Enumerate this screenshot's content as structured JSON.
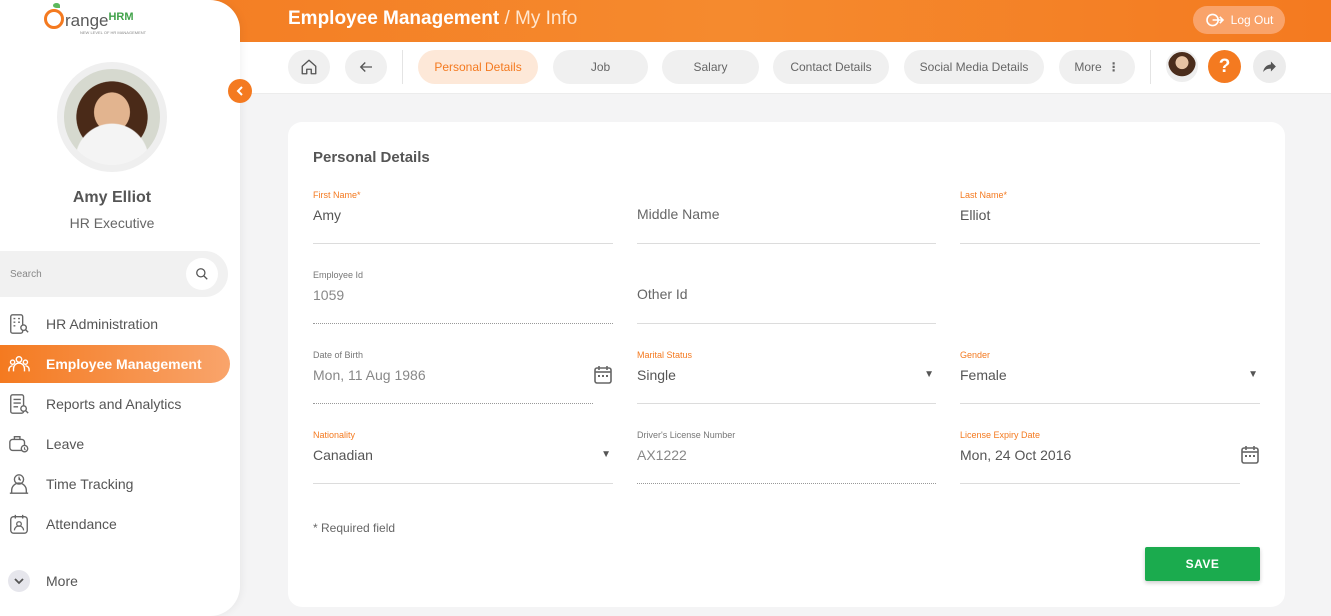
{
  "header": {
    "title": "Employee Management",
    "separator": "/",
    "subtitle": "My Info",
    "logout_label": "Log Out"
  },
  "subnav": {
    "tabs": [
      {
        "label": "Personal Details",
        "active": true
      },
      {
        "label": "Job"
      },
      {
        "label": "Salary"
      },
      {
        "label": "Contact Details"
      },
      {
        "label": "Social Media Details"
      },
      {
        "label": "More"
      }
    ],
    "help_glyph": "?"
  },
  "sidebar": {
    "logo_word": "range",
    "logo_hrm": "HRM",
    "logo_tagline": "NEW LEVEL OF HR MANAGEMENT",
    "user_name": "Amy Elliot",
    "user_role": "HR Executive",
    "search_placeholder": "Search",
    "items": [
      {
        "label": "HR Administration",
        "icon": "building-icon"
      },
      {
        "label": "Employee Management",
        "icon": "people-icon",
        "active": true
      },
      {
        "label": "Reports and Analytics",
        "icon": "report-icon"
      },
      {
        "label": "Leave",
        "icon": "leave-icon"
      },
      {
        "label": "Time Tracking",
        "icon": "clock-user-icon"
      },
      {
        "label": "Attendance",
        "icon": "attendance-icon"
      }
    ],
    "more_label": "More"
  },
  "form": {
    "title": "Personal Details",
    "first_name": {
      "label": "First Name*",
      "value": "Amy"
    },
    "middle_name": {
      "placeholder": "Middle Name"
    },
    "last_name": {
      "label": "Last Name*",
      "value": "Elliot"
    },
    "employee_id": {
      "label": "Employee Id",
      "value": "1059"
    },
    "other_id": {
      "placeholder": "Other Id"
    },
    "dob": {
      "label": "Date of Birth",
      "value": "Mon, 11 Aug 1986"
    },
    "marital_status": {
      "label": "Marital Status",
      "value": "Single"
    },
    "gender": {
      "label": "Gender",
      "value": "Female"
    },
    "nationality": {
      "label": "Nationality",
      "value": "Canadian"
    },
    "drivers_license": {
      "label": "Driver's License Number",
      "value": "AX1222"
    },
    "license_expiry": {
      "label": "License Expiry Date",
      "value": "Mon, 24 Oct 2016"
    },
    "required_note": "* Required field",
    "save_label": "SAVE"
  },
  "colors": {
    "accent": "#f47a20",
    "save": "#1bab4e"
  }
}
